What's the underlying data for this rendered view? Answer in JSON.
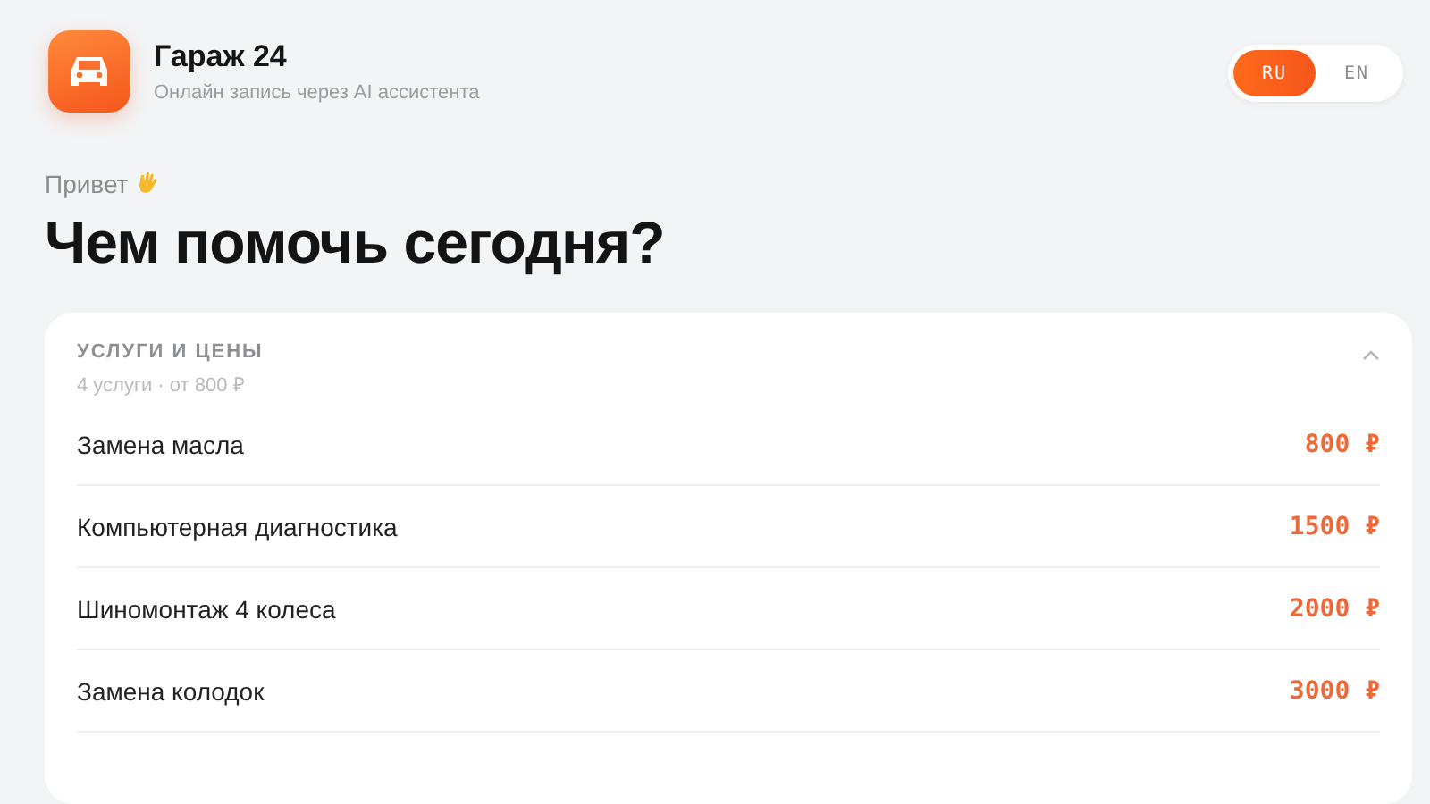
{
  "header": {
    "title": "Гараж 24",
    "subtitle": "Онлайн запись через AI ассистента"
  },
  "languages": [
    {
      "label": "RU",
      "selected": true
    },
    {
      "label": "EN",
      "selected": false
    }
  ],
  "greeting": "Привет",
  "heading": "Чем помочь сегодня?",
  "services": {
    "title": "УСЛУГИ И ЦЕНЫ",
    "summary": "4 услуги · от 800 ₽",
    "expanded": true,
    "items": [
      {
        "name": "Замена масла",
        "price": "800 ₽"
      },
      {
        "name": "Компьютерная диагностика",
        "price": "1500 ₽"
      },
      {
        "name": "Шиномонтаж 4 колеса",
        "price": "2000 ₽"
      },
      {
        "name": "Замена колодок",
        "price": "3000 ₽"
      }
    ]
  }
}
